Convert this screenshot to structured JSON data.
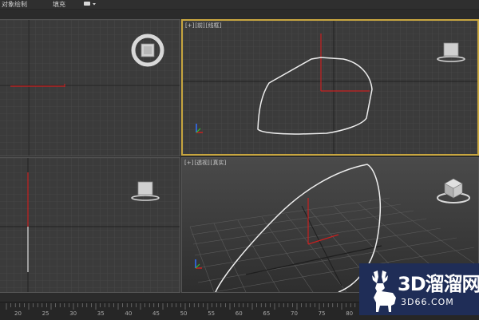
{
  "menu": {
    "object_paint": "对象绘制",
    "fill": "填充"
  },
  "viewports": {
    "top_left": {
      "name": ""
    },
    "top_right": {
      "plus": "[+]",
      "view": "[前]",
      "shading": "[线框]"
    },
    "bottom_left": {
      "name": ""
    },
    "bottom_right": {
      "plus": "[+]",
      "view": "[透视]",
      "shading": "[真实]"
    }
  },
  "timeline": {
    "ticks": [
      "20",
      "25",
      "30",
      "35",
      "40",
      "45",
      "50",
      "55",
      "60",
      "65",
      "70",
      "75",
      "80"
    ]
  },
  "watermark": {
    "main": "3D溜溜网",
    "sub": "3D66.COM"
  },
  "colors": {
    "active_border": "#c8a640",
    "grid": "#4a4a4a",
    "axis_red": "#c82020",
    "spline": "#e8e8e8",
    "logo_bg": "#1f2d57"
  }
}
